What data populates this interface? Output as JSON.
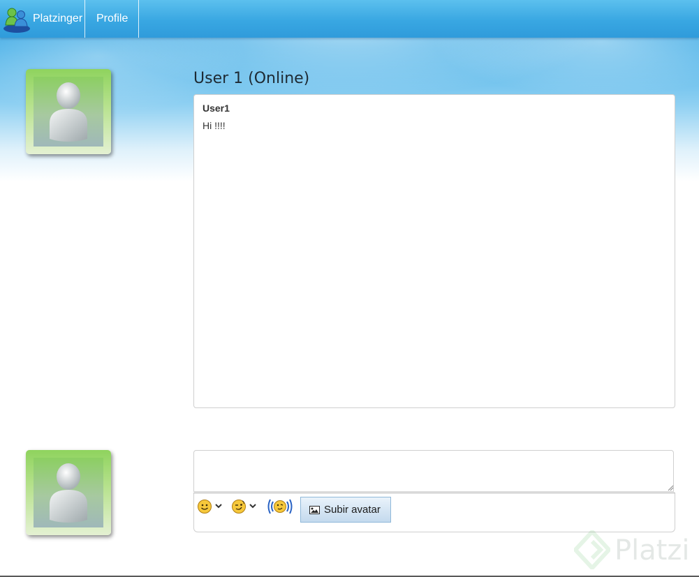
{
  "navbar": {
    "brand_label": "Platzinger",
    "profile_label": "Profile",
    "brand_icon": "messenger-buddy-icon"
  },
  "chat": {
    "title": "User 1 (Online)",
    "messages": [
      {
        "sender": "User1",
        "text": "Hi !!!!"
      }
    ]
  },
  "composer": {
    "message_value": "",
    "emoticon_icon": "smiley-icon",
    "wink_icon": "wink-icon",
    "nudge_icon": "nudge-icon",
    "upload_label": "Subir avatar",
    "upload_icon": "image-icon"
  },
  "watermark": {
    "text": "Platzi"
  },
  "colors": {
    "navbar": "#39a7e2",
    "avatar_green": "#8fd35e",
    "button_bg": "#d6e6f4"
  }
}
